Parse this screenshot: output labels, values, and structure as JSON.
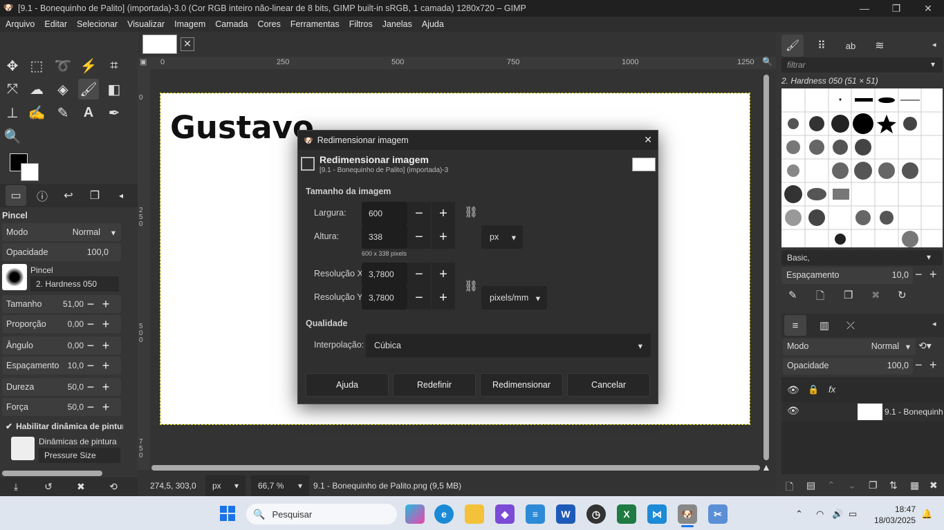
{
  "window": {
    "title": "[9.1 - Bonequinho de Palito] (importada)-3.0 (Cor RGB inteiro não-linear de 8 bits, GIMP built-in sRGB, 1 camada) 1280x720 – GIMP",
    "minimize": "—",
    "maximize": "❐",
    "close": "✕"
  },
  "menu": [
    "Arquivo",
    "Editar",
    "Selecionar",
    "Visualizar",
    "Imagem",
    "Camada",
    "Cores",
    "Ferramentas",
    "Filtros",
    "Janelas",
    "Ajuda"
  ],
  "tool_options": {
    "title": "Pincel",
    "mode_label": "Modo",
    "mode_value": "Normal",
    "opacity_label": "Opacidade",
    "opacity_value": "100,0",
    "brush_label": "Pincel",
    "brush_value": "2. Hardness 050",
    "rows": [
      {
        "label": "Tamanho",
        "value": "51,00"
      },
      {
        "label": "Proporção",
        "value": "0,00"
      },
      {
        "label": "Ângulo",
        "value": "0,00"
      },
      {
        "label": "Espaçamento",
        "value": "10,0"
      },
      {
        "label": "Dureza",
        "value": "50,0"
      },
      {
        "label": "Força",
        "value": "50,0"
      }
    ],
    "dynamics_check": "Habilitar dinâmica de pintur",
    "dynamics_label": "Dinâmicas de pintura",
    "dynamics_value": "Pressure Size"
  },
  "ruler": {
    "h_ticks": [
      "0",
      "250",
      "500",
      "750",
      "1000",
      "1250"
    ],
    "v_ticks": [
      "0",
      "250",
      "500",
      "750"
    ]
  },
  "canvas": {
    "text": "Gustavo"
  },
  "dialog": {
    "window_title": "Redimensionar imagem",
    "heading": "Redimensionar imagem",
    "subheading": "[9.1 - Bonequinho de Palito] (importada)-3",
    "close": "✕",
    "size_section": "Tamanho da imagem",
    "width_label": "Largura:",
    "width_value": "600",
    "height_label": "Altura:",
    "height_value": "338",
    "size_hint": "600 x 338 pixels",
    "unit": "px",
    "resx_label": "Resolução X:",
    "resx_value": "3,7800",
    "resy_label": "Resolução Y:",
    "resy_value": "3,7800",
    "res_unit": "pixels/mm",
    "quality_section": "Qualidade",
    "interp_label": "Interpolação:",
    "interp_value": "Cúbica",
    "buttons": {
      "help": "Ajuda",
      "reset": "Redefinir",
      "resize": "Redimensionar",
      "cancel": "Cancelar"
    }
  },
  "status": {
    "coords": "274,5, 303,0",
    "unit": "px",
    "zoom": "66,7 %",
    "file": "9.1 - Bonequinho de Palito.png (9,5 MB)"
  },
  "brushes": {
    "filter_placeholder": "filtrar",
    "current": "2. Hardness 050 (51 × 51)",
    "tag": "Basic,",
    "spacing_label": "Espaçamento",
    "spacing_value": "10,0"
  },
  "layers": {
    "mode_label": "Modo",
    "mode_value": "Normal",
    "opacity_label": "Opacidade",
    "opacity_value": "100,0",
    "fx": "fx",
    "layer_name": "9.1 - Bonequinh"
  },
  "taskbar": {
    "search": "Pesquisar",
    "time": "18:47",
    "date": "18/03/2025"
  }
}
